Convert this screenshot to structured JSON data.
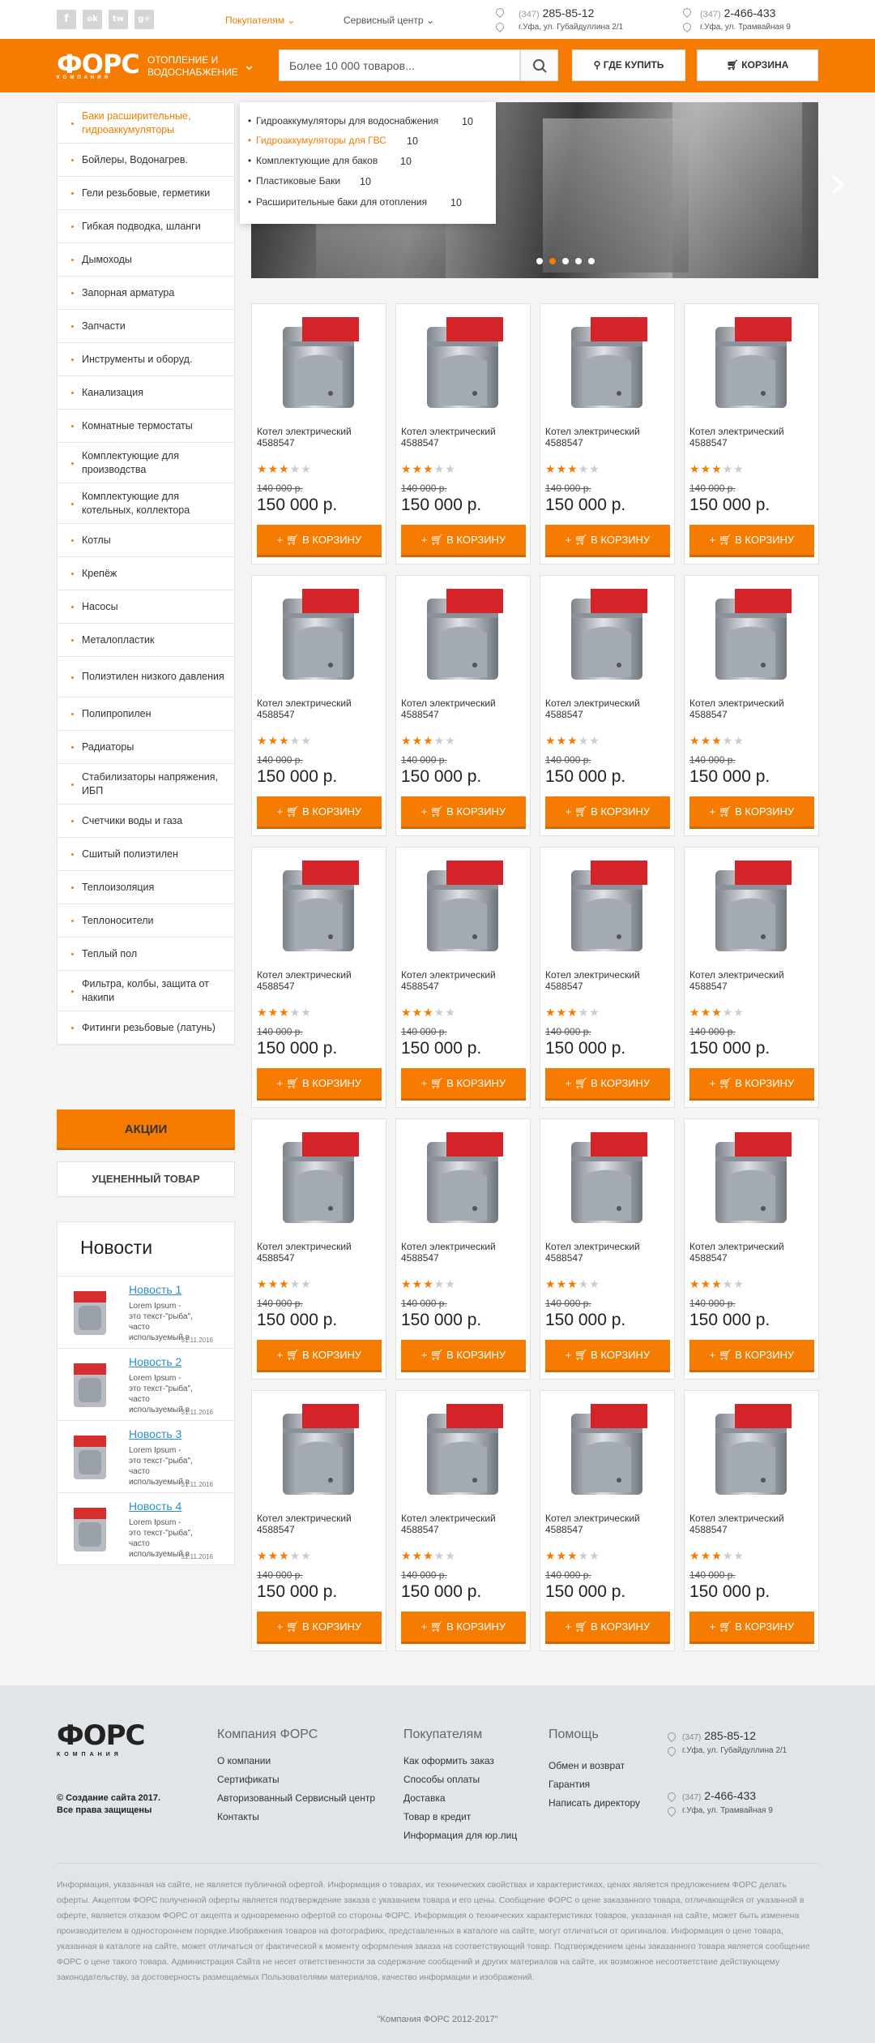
{
  "topbar": {
    "social": [
      "f",
      "ok",
      "tw",
      "g+"
    ],
    "buyers_label": "Покупателям",
    "service_label": "Сервисный центр",
    "contacts": [
      {
        "code": "(347)",
        "phone": "285-85-12",
        "address": "г.Уфа, ул. Губайдуллина 2/1"
      },
      {
        "code": "(347)",
        "phone": "2-466-433",
        "address": "г.Уфа, ул. Трамвайная 9"
      }
    ]
  },
  "header": {
    "logo": "ФОРС",
    "logo_sub": "КОМПАНИЯ",
    "tagline": "ОТОПЛЕНИЕ И ВОДОСНАБЖЕНИЕ",
    "search_placeholder": "Более 10 000 товаров...",
    "where_buy": "ГДЕ КУПИТЬ",
    "cart": "КОРЗИНА"
  },
  "sidebar": {
    "items": [
      "Баки расширительные, гидроаккумуляторы",
      "Бойлеры, Водонагрев.",
      "Гели резьбовые, герметики",
      "Гибкая подводка, шланги",
      "Дымоходы",
      "Запорная арматура",
      "Запчасти",
      "Инструменты и оборуд.",
      "Канализация",
      "Комнатные термостаты",
      "Комплектующие для производства",
      "Комплектующие для котельных, коллектора",
      "Котлы",
      "Крепёж",
      "Насосы",
      "Металопластик",
      "Полиэтилен низкого давления",
      "Полипропилен",
      "Радиаторы",
      "Стабилизаторы напряжения, ИБП",
      "Счетчики воды и газа",
      "Сшитый полиэтилен",
      "Теплоизоляция",
      "Теплоносители",
      "Теплый пол",
      "Фильтра, колбы, защита от накипи",
      "Фитинги резьбовые (латунь)"
    ],
    "akcii": "АКЦИИ",
    "ucenka": "УЦЕНЕННЫЙ ТОВАР"
  },
  "submenu": [
    {
      "label": "Гидроаккумуляторы для водоснабжения",
      "count": "10"
    },
    {
      "label": "Гидроаккумуляторы для ГВС",
      "count": "10"
    },
    {
      "label": "Комплектующие для баков",
      "count": "10"
    },
    {
      "label": "Пластиковые Баки",
      "count": "10"
    },
    {
      "label": "Расширительные баки для  отопления",
      "count": "10"
    }
  ],
  "news": {
    "title": "Новости",
    "items": [
      {
        "title": "Новость 1",
        "text": "Lorem Ipsum - это текст-\"рыба\", часто используемый в",
        "date": "31.11.2016"
      },
      {
        "title": "Новость 2",
        "text": "Lorem Ipsum - это текст-\"рыба\", часто используемый в",
        "date": "31.11.2016"
      },
      {
        "title": "Новость 3",
        "text": "Lorem Ipsum - это текст-\"рыба\", часто используемый в",
        "date": "31.11.2016"
      },
      {
        "title": "Новость 4",
        "text": "Lorem Ipsum - это текст-\"рыба\", часто используемый в",
        "date": "31.11.2016"
      }
    ]
  },
  "product": {
    "name": "Котел электрический 4588547",
    "rating": 3,
    "rating_max": 5,
    "old_price": "140 000 р.",
    "price": "150 000 р.",
    "button": "В КОРЗИНУ",
    "count": 20
  },
  "colors": {
    "accent": "#f57c00",
    "link": "#2a8fcf"
  },
  "footer": {
    "logo": "ФОРС",
    "logo_sub": "КОМПАНИЯ",
    "copyright": "© Создание сайта 2017. Все права защищены",
    "columns": [
      {
        "title": "Компания ФОРС",
        "links": [
          "О компании",
          "Сертификаты",
          "Авторизованный Сервисный центр",
          "Контакты"
        ]
      },
      {
        "title": "Покупателям",
        "links": [
          "Как оформить заказ",
          "Способы оплаты",
          "Доставка",
          "Товар в кредит",
          "Информация для юр.лиц"
        ]
      },
      {
        "title": "Помощь",
        "links": [
          "Обмен и возврат",
          "Гарантия",
          "Написать директору"
        ]
      }
    ],
    "contacts": [
      {
        "code": "(347)",
        "phone": "285-85-12",
        "address": "г.Уфа, ул. Губайдуллина 2/1"
      },
      {
        "code": "(347)",
        "phone": "2-466-433",
        "address": "г.Уфа, ул. Трамвайная 9"
      }
    ],
    "disclaimer": "Информация, указанная на сайте, не является публичной офертой. Информация о товарах, их технических свойствах и характеристиках, ценах является предложением ФОРС делать оферты. Акцептом ФОРС полученной оферты является подтверждение заказа с указанием товара и его цены. Сообщение ФОРС о цене заказанного товара, отличающейся от указанной в оферте, является отказом ФОРС от акцепта и одновременно офертой со стороны ФОРС. Информация о технических характеристиках товаров, указанная на сайте, может быть изменена производителем в одностороннем порядке.Изображения товаров на фотографиях, представленных в каталоге на сайте, могут отличаться от оригиналов. Информация о цене товара, указанная в каталоге на сайте, может отличаться от фактической к моменту оформления заказа на соответствующий товар. Подтверждением цены заказанного товара является сообщение ФОРС о цене такого товара. Администрация Сайта не несет ответственности за содержание сообщений и других материалов на сайте, их возможное несоответствие действующему законодательству, за достоверность размещаемых Пользователями материалов, качество информации и изображений.",
    "bottom": "\"Компания ФОРС  2012-2017\""
  }
}
